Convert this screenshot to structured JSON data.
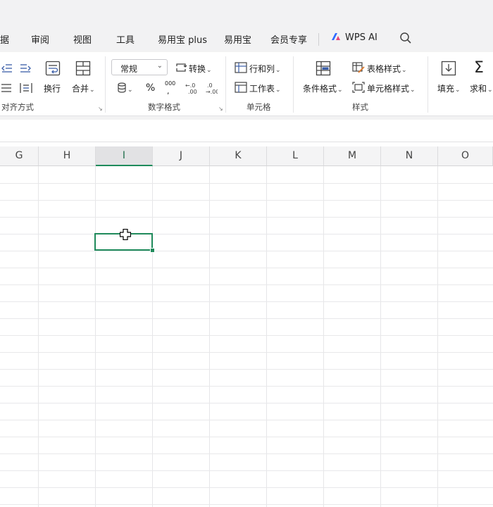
{
  "menu_tabs": {
    "data_partial": "据",
    "review": "审阅",
    "view": "视图",
    "tools": "工具",
    "yiyongbao_plus": "易用宝 plus",
    "yiyongbao": "易用宝",
    "member": "会员专享",
    "wps_ai": "WPS AI"
  },
  "ribbon": {
    "alignment": {
      "wrap_label": "换行",
      "merge_label": "合并",
      "group_label": "对齐方式"
    },
    "number": {
      "format_value": "常规",
      "convert_label": "转换",
      "percent_glyph": "%",
      "thousands_glyph": "000",
      "group_label": "数字格式"
    },
    "cells": {
      "rows_cols_label": "行和列",
      "worksheet_label": "工作表",
      "group_label": "单元格"
    },
    "styles": {
      "conditional_label": "条件格式",
      "table_style_label": "表格样式",
      "cell_style_label": "单元格样式",
      "group_label": "样式"
    },
    "editing": {
      "fill_label": "填充",
      "sum_label": "求和"
    }
  },
  "grid": {
    "columns": [
      "G",
      "H",
      "I",
      "J",
      "K",
      "L",
      "M",
      "N",
      "O"
    ],
    "active_column": "I"
  },
  "colors": {
    "accent": "#1f8a5b",
    "ribbon_icon": "#3a5ea8"
  }
}
